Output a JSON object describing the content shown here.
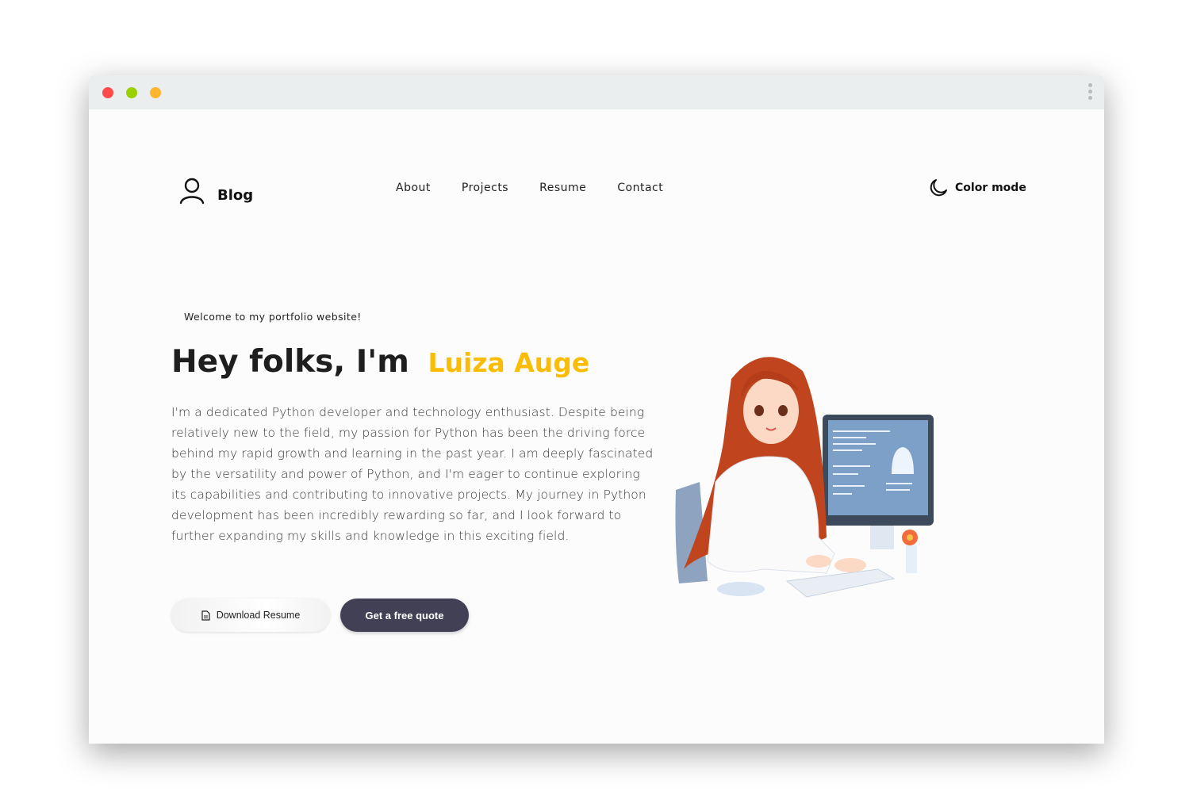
{
  "window": {
    "controls": [
      "close",
      "minimize",
      "maximize"
    ],
    "colors": {
      "close": "#ff4b4b",
      "minimize": "#9bd000",
      "maximize": "#ffb52e"
    }
  },
  "header": {
    "logo_text": "Blog",
    "nav": [
      "About",
      "Projects",
      "Resume",
      "Contact"
    ],
    "color_mode_label": "Color mode"
  },
  "hero": {
    "welcome": "Welcome to my portfolio website!",
    "greeting": "Hey folks, I'm",
    "name": "Luiza Auge",
    "accent_color": "#fbbc05",
    "paragraph_lines": [
      "I'm a dedicated Python developer and technology enthusiast. Despite being",
      "relatively new to the field, my passion for Python has been the driving force",
      "behind my rapid growth and learning in the past year. I am deeply fascinated",
      "by the versatility and power of Python, and I'm eager to continue exploring",
      "its capabilities and contributing to innovative projects. My journey in Python",
      "development has been incredibly rewarding so far, and I look forward to",
      "further expanding my skills and knowledge in this exciting field."
    ],
    "download_label": "Download Resume",
    "quote_label": "Get a free quote"
  }
}
